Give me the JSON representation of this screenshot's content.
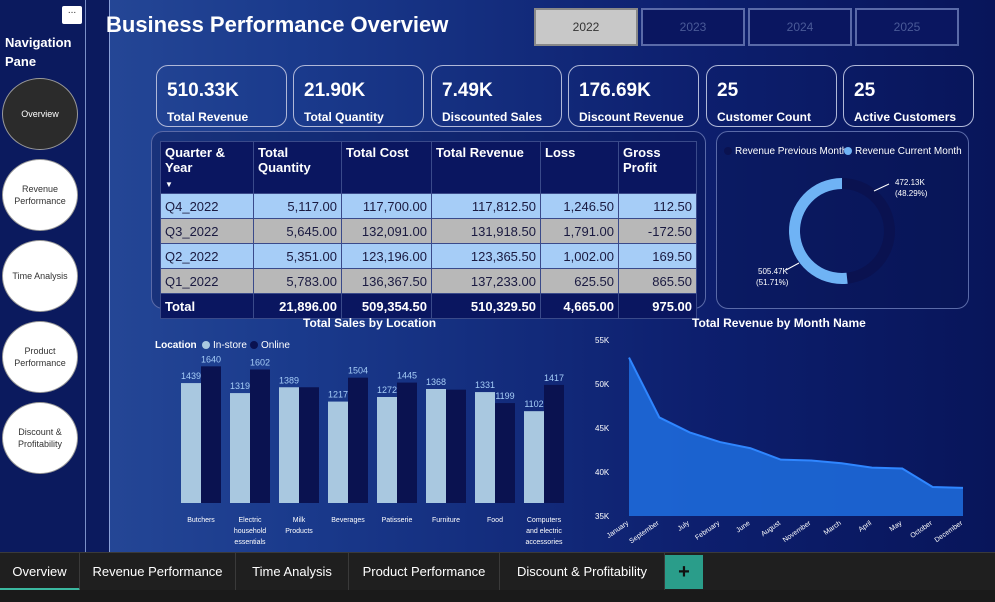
{
  "header": {
    "title": "Business Performance Overview"
  },
  "years": [
    "2022",
    "2023",
    "2024",
    "2025"
  ],
  "nav": {
    "title": "Navigation Pane",
    "menu_label": "...",
    "items": [
      "Overview",
      "Revenue Performance",
      "Time Analysis",
      "Product Performance",
      "Discount & Profitability"
    ]
  },
  "kpis": [
    {
      "value": "510.33K",
      "label": "Total Revenue"
    },
    {
      "value": "21.90K",
      "label": "Total Quantity"
    },
    {
      "value": "7.49K",
      "label": "Discounted Sales"
    },
    {
      "value": "176.69K",
      "label": "Discount Revenue"
    },
    {
      "value": "25",
      "label": "Customer Count"
    },
    {
      "value": "25",
      "label": "Active Customers"
    }
  ],
  "table": {
    "headers": [
      "Quarter & Year",
      "Total Quantity",
      "Total Cost",
      "Total Revenue",
      "Loss",
      "Gross Profit"
    ],
    "rows": [
      [
        "Q4_2022",
        "5,117.00",
        "117,700.00",
        "117,812.50",
        "1,246.50",
        "112.50"
      ],
      [
        "Q3_2022",
        "5,645.00",
        "132,091.00",
        "131,918.50",
        "1,791.00",
        "-172.50"
      ],
      [
        "Q2_2022",
        "5,351.00",
        "123,196.00",
        "123,365.50",
        "1,002.00",
        "169.50"
      ],
      [
        "Q1_2022",
        "5,783.00",
        "136,367.50",
        "137,233.00",
        "625.50",
        "865.50"
      ]
    ],
    "total": [
      "Total",
      "21,896.00",
      "509,354.50",
      "510,329.50",
      "4,665.00",
      "975.00"
    ]
  },
  "donut": {
    "legend_prev": "Revenue Previous Month",
    "legend_curr": "Revenue Current Month",
    "label_prev_value": "472.13K",
    "label_prev_pct": "(48.29%)",
    "label_curr_value": "505.47K",
    "label_curr_pct": "(51.71%)",
    "colors": {
      "prev": "#0a1250",
      "curr": "#6fb3f5"
    }
  },
  "chart_data": [
    {
      "type": "pie",
      "categories": [
        "Revenue Previous Month",
        "Revenue Current Month"
      ],
      "values": [
        472130,
        505470
      ],
      "labels": [
        "472.13K (48.29%)",
        "505.47K (51.71%)"
      ]
    },
    {
      "type": "bar",
      "title": "Total Sales by Location",
      "legend_title": "Location",
      "categories": [
        "Butchers",
        "Electric household essentials",
        "Milk Products",
        "Beverages",
        "Patisserie",
        "Furniture",
        "Food",
        "Computers and electric accessories"
      ],
      "category_lines": [
        [
          "Butchers"
        ],
        [
          "Electric",
          "household",
          "essentials"
        ],
        [
          "Milk",
          "Products"
        ],
        [
          "Beverages"
        ],
        [
          "Patisserie"
        ],
        [
          "Furniture"
        ],
        [
          "Food"
        ],
        [
          "Computers",
          "and electric",
          "accessories"
        ]
      ],
      "series": [
        {
          "name": "In-store",
          "color": "#a9c8e0",
          "values": [
            1439,
            1319,
            1389,
            1217,
            1272,
            1368,
            1331,
            1102
          ]
        },
        {
          "name": "Online",
          "color": "#0a1250",
          "values": [
            1640,
            1602,
            null,
            1504,
            1445,
            null,
            1199,
            1417
          ]
        }
      ],
      "online_unlabeled_estimates": [
        null,
        null,
        1389,
        null,
        null,
        1360,
        null,
        null
      ],
      "ylim": [
        0,
        1800
      ]
    },
    {
      "type": "area",
      "title": "Total Revenue by Month Name",
      "categories": [
        "January",
        "September",
        "July",
        "February",
        "June",
        "August",
        "November",
        "March",
        "April",
        "May",
        "October",
        "December"
      ],
      "values": [
        53000,
        46200,
        44500,
        43400,
        42700,
        41400,
        41300,
        41000,
        40500,
        40400,
        38300,
        38200
      ],
      "yticks": [
        "55K",
        "50K",
        "45K",
        "40K",
        "35K"
      ],
      "ylim": [
        35000,
        55000
      ],
      "color": "#1e6fe0"
    }
  ],
  "bottom_tabs": [
    "Overview",
    "Revenue Performance",
    "Time Analysis",
    "Product Performance",
    "Discount & Profitability"
  ],
  "add_tab": "+"
}
